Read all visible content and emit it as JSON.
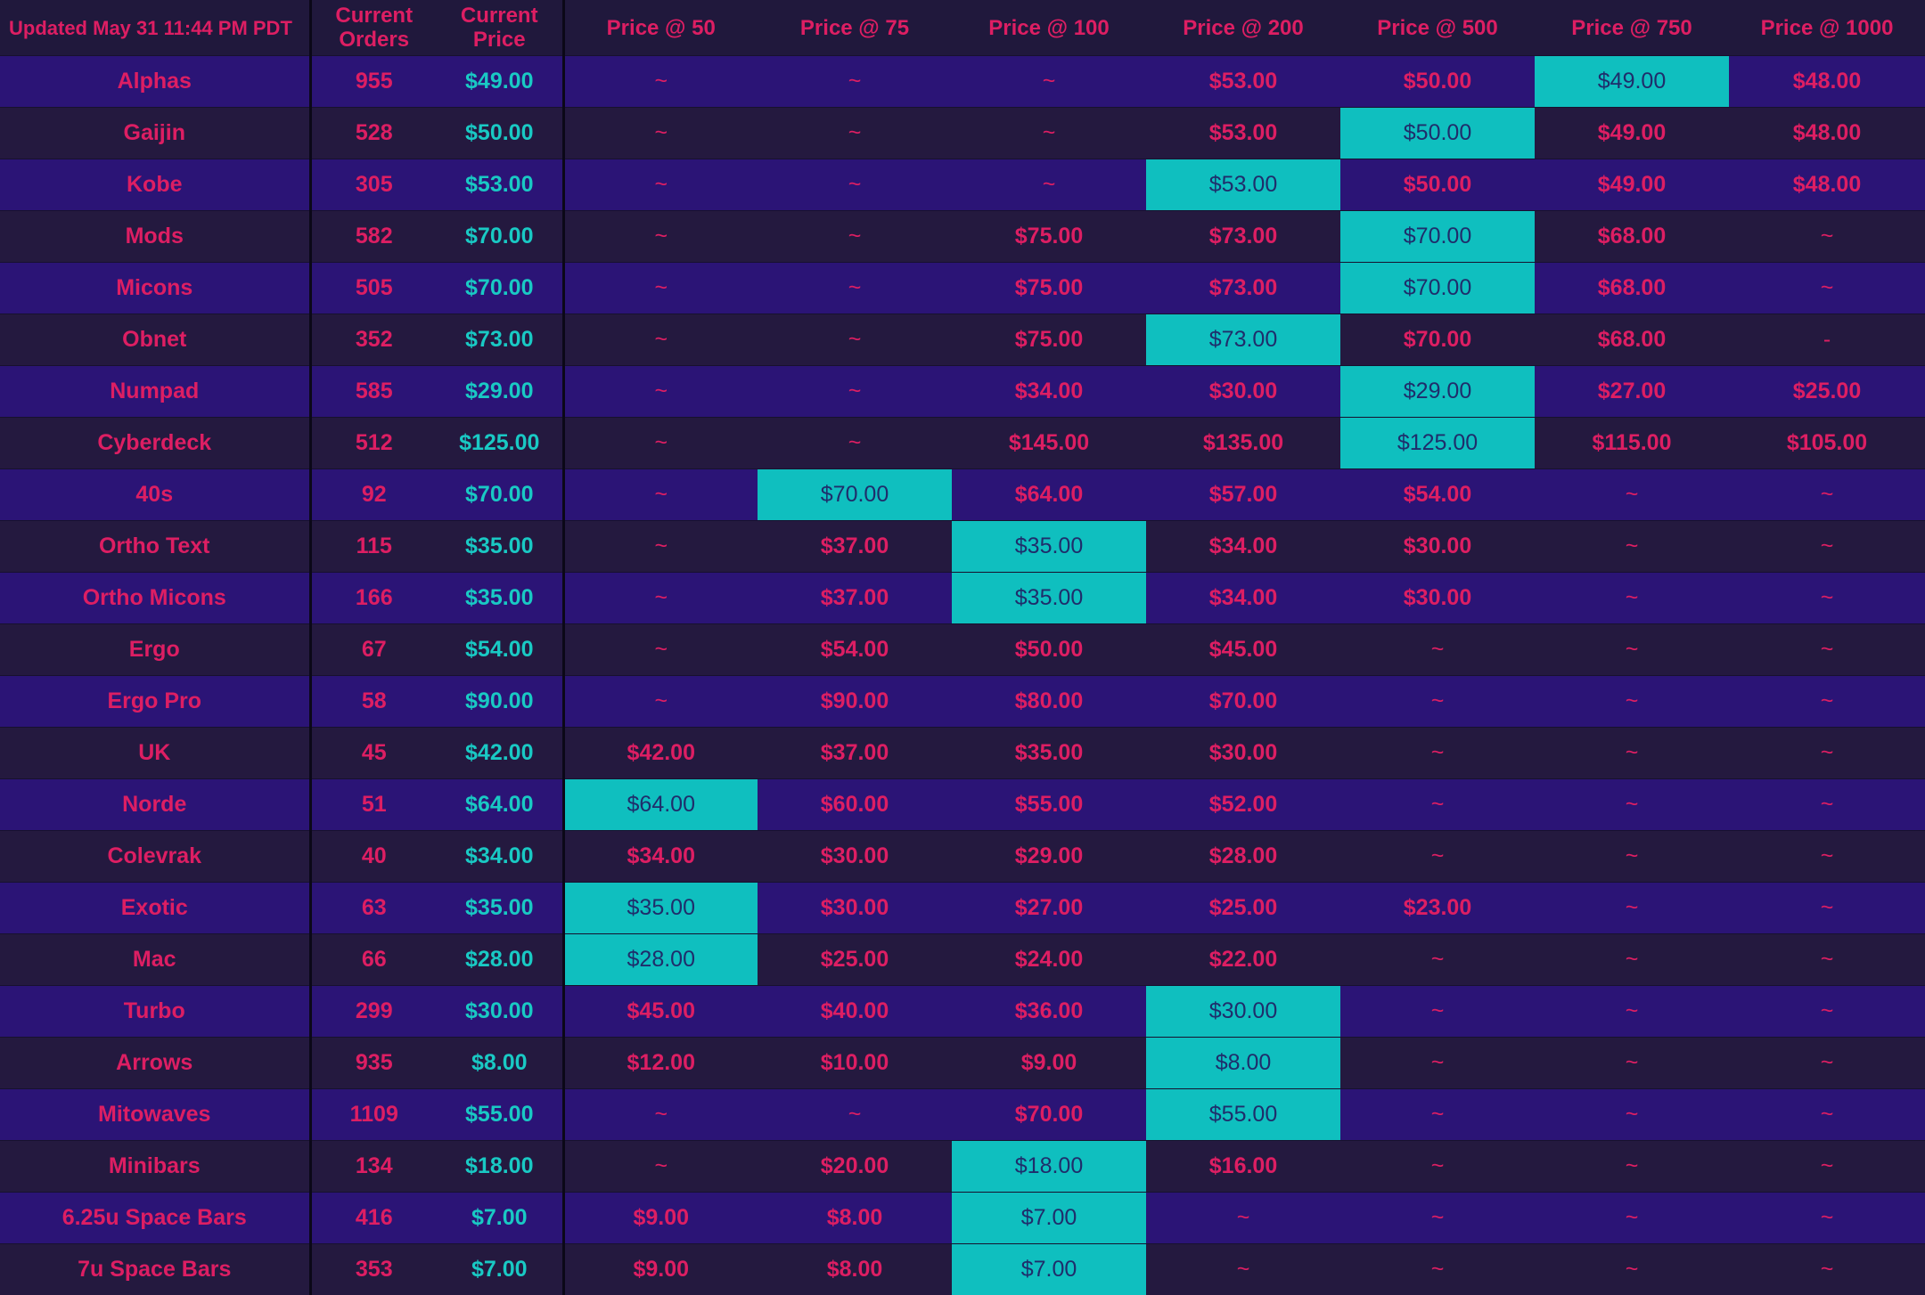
{
  "header": {
    "updated": "Updated May 31  11:44 PM PDT",
    "current_orders": [
      "Current",
      "Orders"
    ],
    "current_price": [
      "Current",
      "Price"
    ],
    "tiers": [
      "Price @ 50",
      "Price @ 75",
      "Price @ 100",
      "Price @ 200",
      "Price @ 500",
      "Price @ 750",
      "Price @ 1000"
    ]
  },
  "colors": {
    "row_odd": "#2b1476",
    "row_even": "#24193f",
    "text": "#dd1e63",
    "current_price_text": "#19c9c4",
    "highlight": "#0fbfbf"
  },
  "chart_data": {
    "type": "table",
    "columns": [
      "Current Orders",
      "Current Price",
      "Price @ 50",
      "Price @ 75",
      "Price @ 100",
      "Price @ 200",
      "Price @ 500",
      "Price @ 750",
      "Price @ 1000"
    ],
    "rows": [
      {
        "name": "Alphas",
        "orders": "955",
        "price": "$49.00",
        "tiers": [
          "~",
          "~",
          "~",
          "$53.00",
          "$50.00",
          "$49.00",
          "$48.00"
        ],
        "hl": 5
      },
      {
        "name": "Gaijin",
        "orders": "528",
        "price": "$50.00",
        "tiers": [
          "~",
          "~",
          "~",
          "$53.00",
          "$50.00",
          "$49.00",
          "$48.00"
        ],
        "hl": 4
      },
      {
        "name": "Kobe",
        "orders": "305",
        "price": "$53.00",
        "tiers": [
          "~",
          "~",
          "~",
          "$53.00",
          "$50.00",
          "$49.00",
          "$48.00"
        ],
        "hl": 3
      },
      {
        "name": "Mods",
        "orders": "582",
        "price": "$70.00",
        "tiers": [
          "~",
          "~",
          "$75.00",
          "$73.00",
          "$70.00",
          "$68.00",
          "~"
        ],
        "hl": 4
      },
      {
        "name": "Micons",
        "orders": "505",
        "price": "$70.00",
        "tiers": [
          "~",
          "~",
          "$75.00",
          "$73.00",
          "$70.00",
          "$68.00",
          "~"
        ],
        "hl": 4
      },
      {
        "name": "Obnet",
        "orders": "352",
        "price": "$73.00",
        "tiers": [
          "~",
          "~",
          "$75.00",
          "$73.00",
          "$70.00",
          "$68.00",
          "-"
        ],
        "hl": 3
      },
      {
        "name": "Numpad",
        "orders": "585",
        "price": "$29.00",
        "tiers": [
          "~",
          "~",
          "$34.00",
          "$30.00",
          "$29.00",
          "$27.00",
          "$25.00"
        ],
        "hl": 4
      },
      {
        "name": "Cyberdeck",
        "orders": "512",
        "price": "$125.00",
        "tiers": [
          "~",
          "~",
          "$145.00",
          "$135.00",
          "$125.00",
          "$115.00",
          "$105.00"
        ],
        "hl": 4
      },
      {
        "name": "40s",
        "orders": "92",
        "price": "$70.00",
        "tiers": [
          "~",
          "$70.00",
          "$64.00",
          "$57.00",
          "$54.00",
          "~",
          "~"
        ],
        "hl": 1
      },
      {
        "name": "Ortho Text",
        "orders": "115",
        "price": "$35.00",
        "tiers": [
          "~",
          "$37.00",
          "$35.00",
          "$34.00",
          "$30.00",
          "~",
          "~"
        ],
        "hl": 2
      },
      {
        "name": "Ortho Micons",
        "orders": "166",
        "price": "$35.00",
        "tiers": [
          "~",
          "$37.00",
          "$35.00",
          "$34.00",
          "$30.00",
          "~",
          "~"
        ],
        "hl": 2
      },
      {
        "name": "Ergo",
        "orders": "67",
        "price": "$54.00",
        "tiers": [
          "~",
          "$54.00",
          "$50.00",
          "$45.00",
          "~",
          "~",
          "~"
        ],
        "hl": -1
      },
      {
        "name": "Ergo Pro",
        "orders": "58",
        "price": "$90.00",
        "tiers": [
          "~",
          "$90.00",
          "$80.00",
          "$70.00",
          "~",
          "~",
          "~"
        ],
        "hl": -1
      },
      {
        "name": "UK",
        "orders": "45",
        "price": "$42.00",
        "tiers": [
          "$42.00",
          "$37.00",
          "$35.00",
          "$30.00",
          "~",
          "~",
          "~"
        ],
        "hl": -1
      },
      {
        "name": "Norde",
        "orders": "51",
        "price": "$64.00",
        "tiers": [
          "$64.00",
          "$60.00",
          "$55.00",
          "$52.00",
          "~",
          "~",
          "~"
        ],
        "hl": 0
      },
      {
        "name": "Colevrak",
        "orders": "40",
        "price": "$34.00",
        "tiers": [
          "$34.00",
          "$30.00",
          "$29.00",
          "$28.00",
          "~",
          "~",
          "~"
        ],
        "hl": -1
      },
      {
        "name": "Exotic",
        "orders": "63",
        "price": "$35.00",
        "tiers": [
          "$35.00",
          "$30.00",
          "$27.00",
          "$25.00",
          "$23.00",
          "~",
          "~"
        ],
        "hl": 0
      },
      {
        "name": "Mac",
        "orders": "66",
        "price": "$28.00",
        "tiers": [
          "$28.00",
          "$25.00",
          "$24.00",
          "$22.00",
          "~",
          "~",
          "~"
        ],
        "hl": 0
      },
      {
        "name": "Turbo",
        "orders": "299",
        "price": "$30.00",
        "tiers": [
          "$45.00",
          "$40.00",
          "$36.00",
          "$30.00",
          "~",
          "~",
          "~"
        ],
        "hl": 3
      },
      {
        "name": "Arrows",
        "orders": "935",
        "price": "$8.00",
        "tiers": [
          "$12.00",
          "$10.00",
          "$9.00",
          "$8.00",
          "~",
          "~",
          "~"
        ],
        "hl": 3
      },
      {
        "name": "Mitowaves",
        "orders": "1109",
        "price": "$55.00",
        "tiers": [
          "~",
          "~",
          "$70.00",
          "$55.00",
          "~",
          "~",
          "~"
        ],
        "hl": 3
      },
      {
        "name": "Minibars",
        "orders": "134",
        "price": "$18.00",
        "tiers": [
          "~",
          "$20.00",
          "$18.00",
          "$16.00",
          "~",
          "~",
          "~"
        ],
        "hl": 2
      },
      {
        "name": "6.25u Space Bars",
        "orders": "416",
        "price": "$7.00",
        "tiers": [
          "$9.00",
          "$8.00",
          "$7.00",
          "~",
          "~",
          "~",
          "~"
        ],
        "hl": 2
      },
      {
        "name": "7u Space Bars",
        "orders": "353",
        "price": "$7.00",
        "tiers": [
          "$9.00",
          "$8.00",
          "$7.00",
          "~",
          "~",
          "~",
          "~"
        ],
        "hl": 2
      }
    ]
  }
}
